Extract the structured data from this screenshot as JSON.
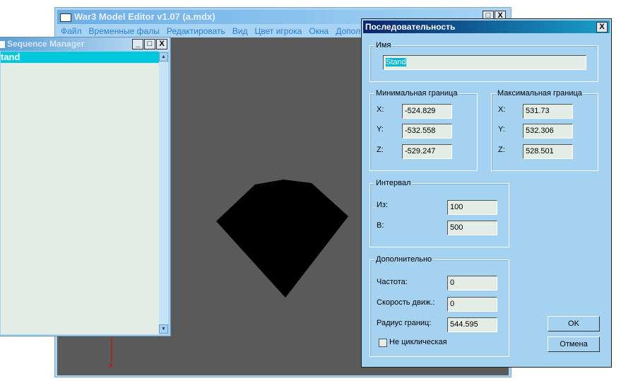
{
  "main_window": {
    "title": "War3 Model Editor v1.07 (a.mdx)",
    "menu": [
      "Файл",
      "Временные фалы",
      "Редактировать",
      "Вид",
      "Цвет игрока",
      "Окна",
      "Дополнит"
    ],
    "axis_label": "x"
  },
  "sequence_manager": {
    "title": "Sequence Manager",
    "items": [
      "tand"
    ]
  },
  "dialog": {
    "title": "Последовательность",
    "name_group": "Имя",
    "name_value": "Stand",
    "min_group": "Минимальная граница",
    "max_group": "Максимальная граница",
    "min": {
      "x_label": "X:",
      "y_label": "Y:",
      "z_label": "Z:",
      "x": "-524.829",
      "y": "-532.558",
      "z": "-529.247"
    },
    "max": {
      "x_label": "X:",
      "y_label": "Y:",
      "z_label": "Z:",
      "x": "531.73",
      "y": "532.306",
      "z": "528.501"
    },
    "interval_group": "Интервал",
    "from_label": "Из:",
    "from": "100",
    "to_label": "В:",
    "to": "500",
    "extra_group": "Дополнительно",
    "freq_label": "Частота:",
    "freq": "0",
    "speed_label": "Скорость движ.:",
    "speed": "0",
    "radius_label": "Радиус границ:",
    "radius": "544.595",
    "nonloop_label": "Не циклическая",
    "nonloop_checked": false,
    "ok": "OK",
    "cancel": "Отмена"
  },
  "buttons": {
    "min": "_",
    "max": "□",
    "close": "X"
  }
}
